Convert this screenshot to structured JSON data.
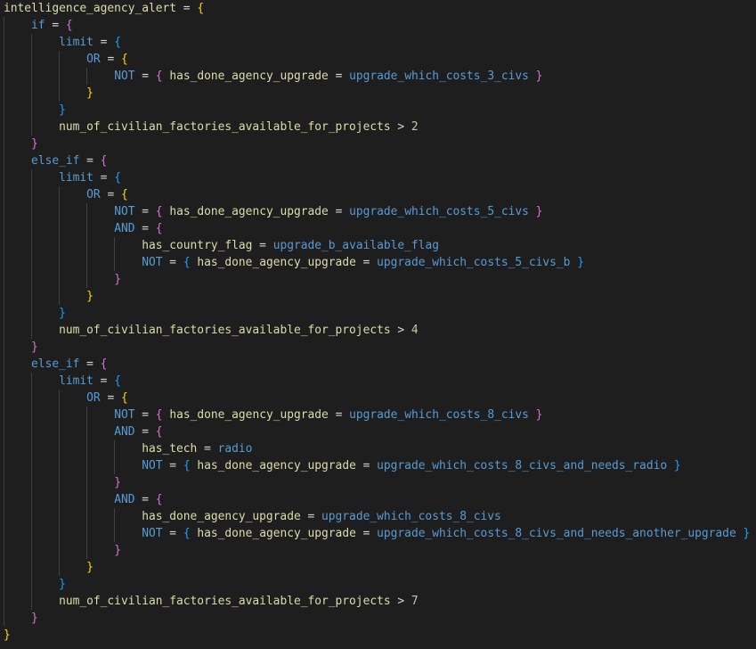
{
  "code": {
    "root_key": "intelligence_agency_alert",
    "eq": "=",
    "gt": ">",
    "open_brace": "{",
    "close_brace": "}",
    "kw_if": "if",
    "kw_else_if": "else_if",
    "kw_limit": "limit",
    "kw_or": "OR",
    "kw_and": "AND",
    "kw_not": "NOT",
    "trigger_agency": "has_done_agency_upgrade",
    "trigger_country_flag": "has_country_flag",
    "trigger_tech": "has_tech",
    "trigger_factories": "num_of_civilian_factories_available_for_projects",
    "upgrade_3": "upgrade_which_costs_3_civs",
    "upgrade_5": "upgrade_which_costs_5_civs",
    "flag_b": "upgrade_b_available_flag",
    "upgrade_5b": "upgrade_which_costs_5_civs_b",
    "upgrade_8": "upgrade_which_costs_8_civs",
    "tech_radio": "radio",
    "upgrade_8_radio": "upgrade_which_costs_8_civs_and_needs_radio",
    "upgrade_8_another": "upgrade_which_costs_8_civs_and_needs_another_upgrade",
    "num_2": "2",
    "num_4": "4",
    "num_7": "7"
  },
  "colors": {
    "background": "#1e1e1e",
    "key_yellow": "#dcdcaa",
    "keyword_blue": "#569cd6",
    "identifier_light_blue": "#9cdcfe",
    "number_green": "#b5cea8",
    "bracket_gold": "#ffd700",
    "bracket_orchid": "#da70d6",
    "bracket_blue": "#179fff"
  }
}
